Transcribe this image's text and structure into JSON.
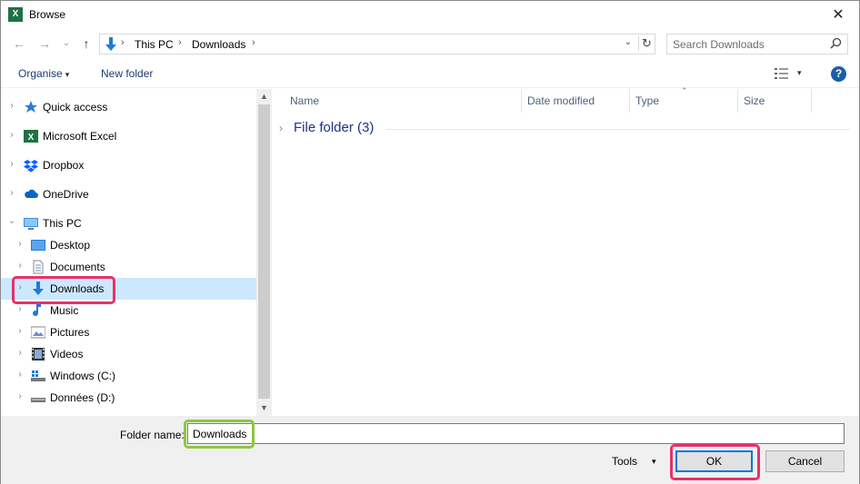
{
  "window": {
    "title": "Browse",
    "app_icon_letter": "X",
    "close_symbol": "✕"
  },
  "nav": {
    "back": "←",
    "forward": "→",
    "recent": "⌄",
    "up": "↑"
  },
  "address": {
    "crumbs": [
      "This PC",
      "Downloads"
    ],
    "separator": "›",
    "dropdown": "⌄",
    "refresh": "↻"
  },
  "search": {
    "placeholder": "Search Downloads"
  },
  "toolbar": {
    "organise_label": "Organise",
    "organise_caret": "▾",
    "new_folder_label": "New folder",
    "view_caret": "▾",
    "help": "?"
  },
  "navpane": {
    "items": [
      {
        "label": "Quick access",
        "icon": "star-icon"
      },
      {
        "label": "Microsoft Excel",
        "icon": "excel-icon"
      },
      {
        "label": "Dropbox",
        "icon": "dropbox-icon"
      },
      {
        "label": "OneDrive",
        "icon": "cloud-icon"
      },
      {
        "label": "This PC",
        "icon": "computer-icon"
      },
      {
        "label": "Desktop",
        "icon": "desktop-icon"
      },
      {
        "label": "Documents",
        "icon": "documents-icon"
      },
      {
        "label": "Downloads",
        "icon": "downloads-icon",
        "selected": true
      },
      {
        "label": "Music",
        "icon": "music-icon"
      },
      {
        "label": "Pictures",
        "icon": "pictures-icon"
      },
      {
        "label": "Videos",
        "icon": "videos-icon"
      },
      {
        "label": "Windows (C:)",
        "icon": "drive-c-icon"
      },
      {
        "label": "Données (D:)",
        "icon": "drive-d-icon"
      }
    ]
  },
  "columns": [
    "Name",
    "Date modified",
    "Type",
    "Size"
  ],
  "group": {
    "label": "File folder (3)",
    "chevron": "›"
  },
  "bottom": {
    "folder_name_label": "Folder name:",
    "folder_name_value": "Downloads",
    "tools_label": "Tools",
    "tools_caret": "▾",
    "ok_label": "OK",
    "cancel_label": "Cancel"
  },
  "colors": {
    "selection": "#cce8ff",
    "highlight_pink": "#e8316b",
    "highlight_green": "#8cc63f",
    "accent": "#0078d7"
  }
}
